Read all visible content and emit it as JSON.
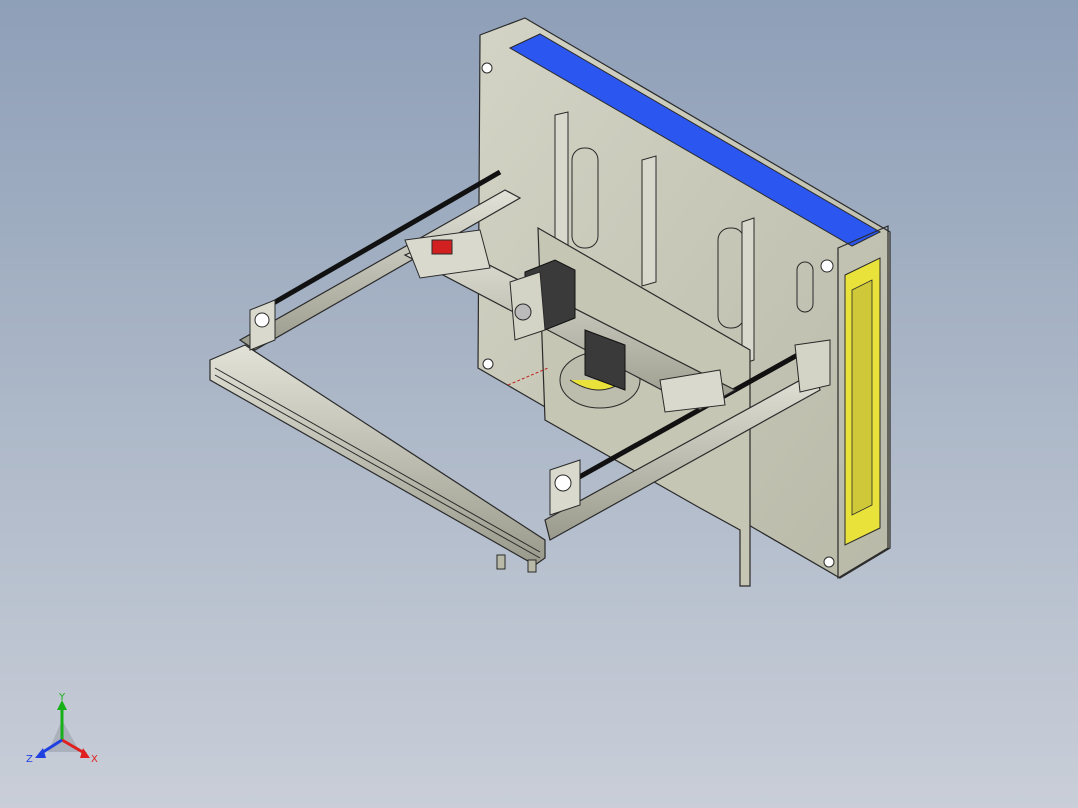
{
  "viewport": {
    "background_top": "#8e9fb8",
    "background_bottom": "#c9ced8"
  },
  "model": {
    "part_color": "#c9c9b8",
    "edge_color": "#2a2a2a",
    "accent_blue": "#2b57f0",
    "accent_yellow": "#e8e23a",
    "accent_red": "#d22020",
    "motor_color": "#3a3a3a"
  },
  "triad": {
    "x_label": "X",
    "y_label": "Y",
    "z_label": "Z",
    "x_color": "#e02020",
    "y_color": "#18b018",
    "z_color": "#2040e0"
  }
}
